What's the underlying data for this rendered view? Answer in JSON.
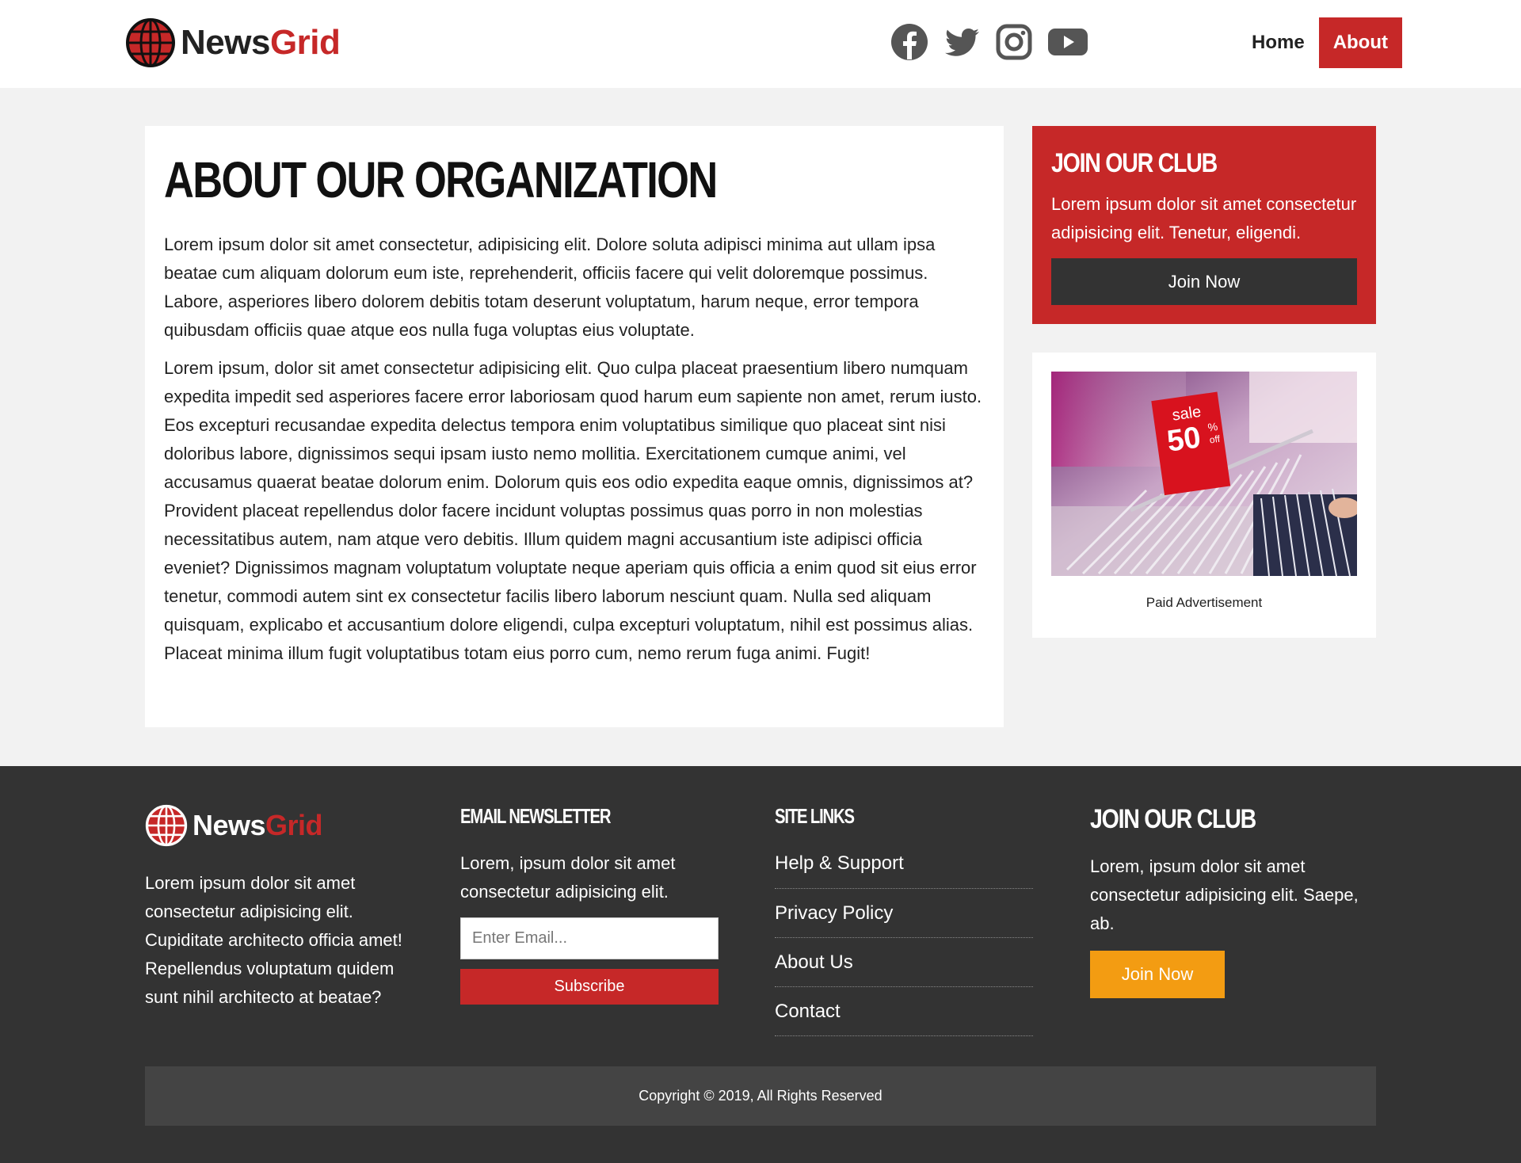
{
  "brand": {
    "name_part1": "News",
    "name_part2": "Grid"
  },
  "colors": {
    "accent": "#c62828",
    "dark": "#333333",
    "orange": "#f39c12",
    "background": "#f2f2f2"
  },
  "social": [
    "facebook-icon",
    "twitter-icon",
    "instagram-icon",
    "youtube-icon"
  ],
  "nav": {
    "home": "Home",
    "about": "About"
  },
  "article": {
    "title": "About Our Organization",
    "p1": "Lorem ipsum dolor sit amet consectetur, adipisicing elit. Dolore soluta adipisci minima aut ullam ipsa beatae cum aliquam dolorum eum iste, reprehenderit, officiis facere qui velit doloremque possimus. Labore, asperiores libero dolorem debitis totam deserunt voluptatum, harum neque, error tempora quibusdam officiis quae atque eos nulla fuga voluptas eius voluptate.",
    "p2": "Lorem ipsum, dolor sit amet consectetur adipisicing elit. Quo culpa placeat praesentium libero numquam expedita impedit sed asperiores facere error laboriosam quod harum eum sapiente non amet, rerum iusto. Eos excepturi recusandae expedita delectus tempora enim voluptatibus similique quo placeat sint nisi doloribus labore, dignissimos sequi ipsam iusto nemo mollitia. Exercitationem cumque animi, vel accusamus quaerat beatae dolorum enim. Dolorum quis eos odio expedita eaque omnis, dignissimos at? Provident placeat repellendus dolor facere incidunt voluptas possimus quas porro in non molestias necessitatibus autem, nam atque vero debitis. Illum quidem magni accusantium iste adipisci officia eveniet? Dignissimos magnam voluptatum voluptate neque aperiam quis officia a enim quod sit eius error tenetur, commodi autem sint ex consectetur facilis libero laborum nesciunt quam. Nulla sed aliquam quisquam, explicabo et accusantium dolore eligendi, culpa excepturi voluptatum, nihil est possimus alias. Placeat minima illum fugit voluptatibus totam eius porro cum, nemo rerum fuga animi. Fugit!"
  },
  "sidebar": {
    "club_title": "Join Our Club",
    "club_text": "Lorem ipsum dolor sit amet consectetur adipisicing elit. Tenetur, eligendi.",
    "club_button": "Join Now",
    "ad_sign_top": "sale",
    "ad_sign_value": "50",
    "ad_sign_percent": "%",
    "ad_sign_off": "off",
    "ad_caption": "Paid Advertisement"
  },
  "footer": {
    "about_text": "Lorem ipsum dolor sit amet consectetur adipisicing elit. Cupiditate architecto officia amet! Repellendus voluptatum quidem sunt nihil architecto at beatae?",
    "newsletter_title": "Email Newsletter",
    "newsletter_text": "Lorem, ipsum dolor sit amet consectetur adipisicing elit.",
    "email_placeholder": "Enter Email...",
    "subscribe_label": "Subscribe",
    "links_title": "Site Links",
    "links": [
      "Help & Support",
      "Privacy Policy",
      "About Us",
      "Contact"
    ],
    "club_title": "Join Our Club",
    "club_text": "Lorem, ipsum dolor sit amet consectetur adipisicing elit. Saepe, ab.",
    "club_button": "Join Now",
    "copyright": "Copyright © 2019, All Rights Reserved"
  }
}
